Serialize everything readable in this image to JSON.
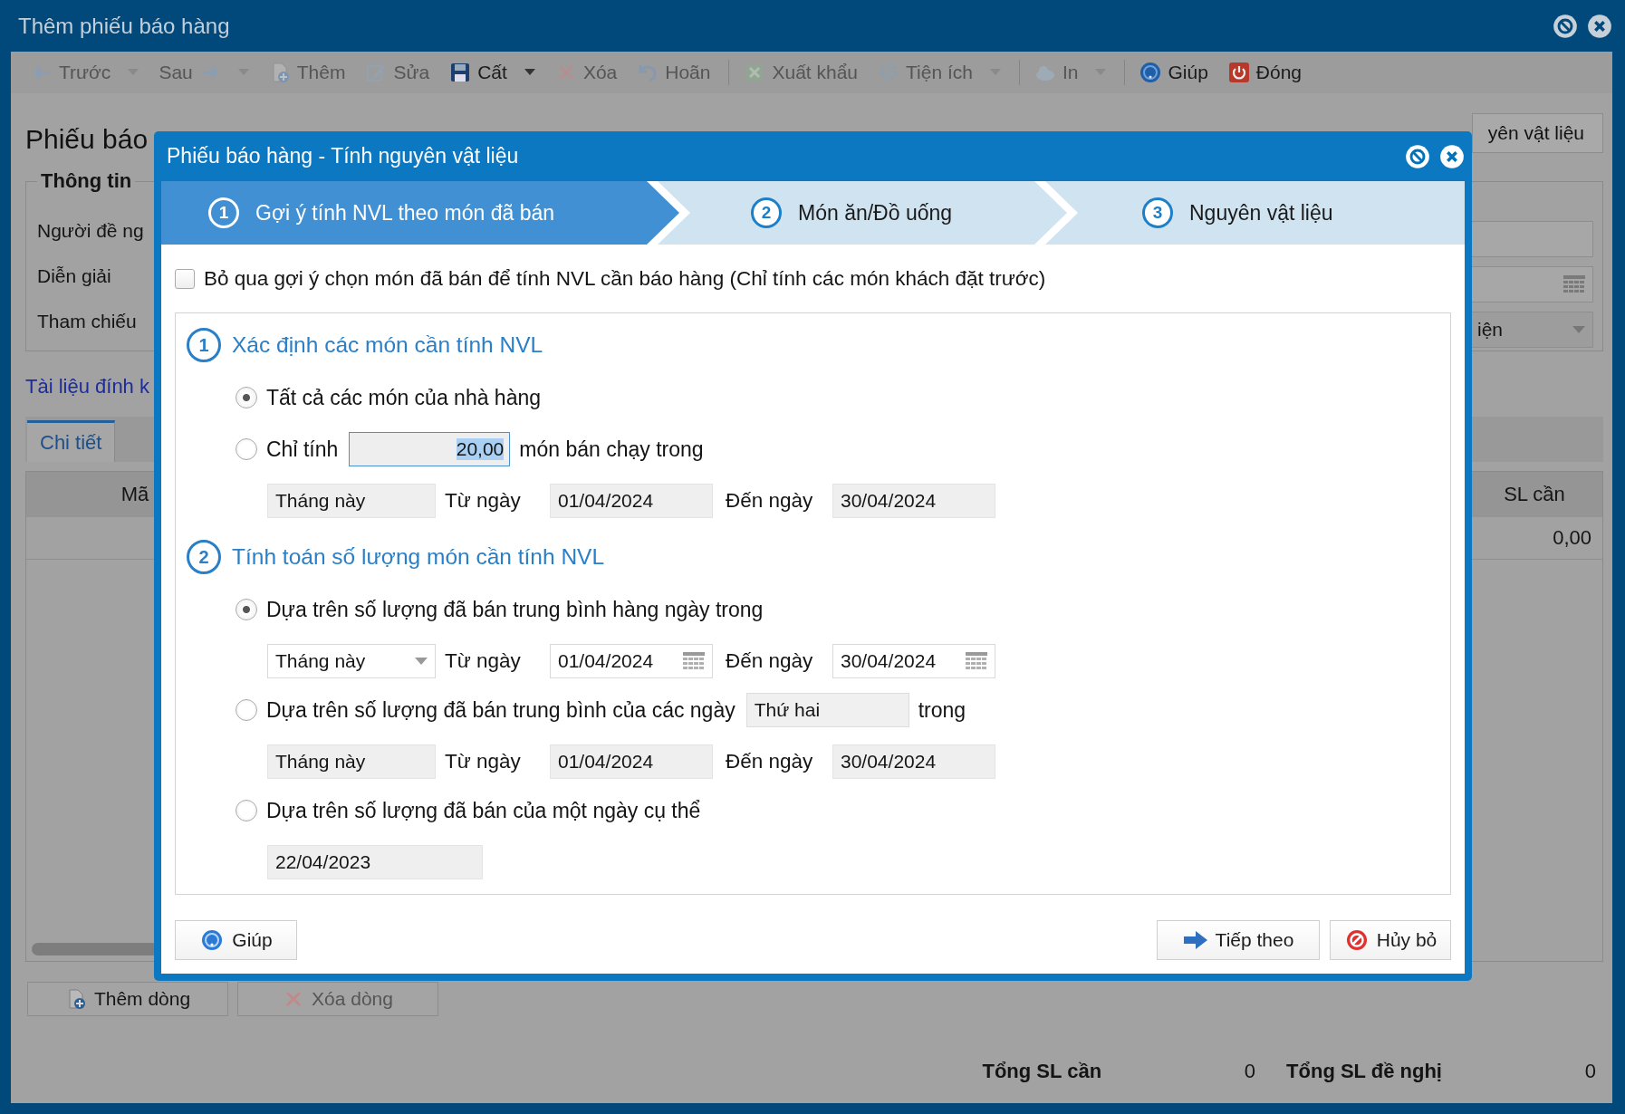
{
  "window": {
    "title": "Thêm phiếu báo hàng"
  },
  "toolbar": [
    {
      "label": "Trước",
      "kind": "back",
      "disabled": true,
      "dropdown": true,
      "group_start": false
    },
    {
      "label": "Sau",
      "kind": "forward",
      "disabled": true,
      "dropdown": true,
      "group_start": false
    },
    {
      "label": "Thêm",
      "kind": "add",
      "disabled": true,
      "dropdown": false,
      "group_start": false
    },
    {
      "label": "Sửa",
      "kind": "edit",
      "disabled": true,
      "dropdown": false,
      "group_start": false
    },
    {
      "label": "Cất",
      "kind": "save",
      "disabled": false,
      "dropdown": true,
      "group_start": false
    },
    {
      "label": "Xóa",
      "kind": "delete",
      "disabled": true,
      "dropdown": false,
      "group_start": false
    },
    {
      "label": "Hoãn",
      "kind": "undo",
      "disabled": true,
      "dropdown": false,
      "group_start": false
    },
    {
      "label": "Xuất khẩu",
      "kind": "export",
      "disabled": true,
      "dropdown": false,
      "group_start": true
    },
    {
      "label": "Tiện ích",
      "kind": "tools",
      "disabled": true,
      "dropdown": true,
      "group_start": false
    },
    {
      "label": "In",
      "kind": "print",
      "disabled": true,
      "dropdown": true,
      "group_start": true
    },
    {
      "label": "Giúp",
      "kind": "help",
      "disabled": false,
      "dropdown": false,
      "group_start": true
    },
    {
      "label": "Đóng",
      "kind": "close",
      "disabled": false,
      "dropdown": false,
      "group_start": false
    }
  ],
  "form": {
    "heading": "Phiếu báo",
    "side_button": "yên vật liệu",
    "group_title": "Thông tin",
    "field_labels": [
      "Người đề ng",
      "Diễn giải",
      "Tham chiếu"
    ],
    "dropdown_value": "iện",
    "attachment_link": "Tài liệu đính k",
    "tabs": [
      {
        "label": "Chi tiết",
        "selected": true
      }
    ],
    "grid": {
      "columns": [
        "Mã",
        "SL cần"
      ],
      "rows": [
        [
          "0,00"
        ]
      ]
    },
    "buttons": [
      {
        "label": "Thêm dòng",
        "kind": "add",
        "disabled": false
      },
      {
        "label": "Xóa dòng",
        "kind": "delete",
        "disabled": true
      }
    ],
    "totals": [
      {
        "label": "Tổng SL cần",
        "value": "0"
      },
      {
        "label": "Tổng SL đề nghị",
        "value": "0"
      }
    ]
  },
  "dialog": {
    "title": "Phiếu báo hàng - Tính nguyên vật liệu",
    "steps": [
      {
        "number": "1",
        "label": "Gợi ý tính NVL theo món đã bán",
        "selected": true
      },
      {
        "number": "2",
        "label": "Món ăn/Đồ uống",
        "selected": false
      },
      {
        "number": "3",
        "label": "Nguyên vật liệu",
        "selected": false
      }
    ],
    "skip_checkbox": {
      "label": "Bỏ qua gợi ý chọn món đã bán để tính NVL cần báo hàng (Chỉ tính các món khách đặt trước)",
      "checked": false
    },
    "sections": [
      {
        "number": "1",
        "title": "Xác định các món cần tính NVL",
        "options": [
          {
            "label": "Tất cả các món của nhà hàng",
            "selected": true
          },
          {
            "label": "Chỉ tính",
            "field": {
              "value": "20,00",
              "text_selected": true
            },
            "after": "món bán chạy trong",
            "selected": false,
            "period": {
              "value": "Tháng này",
              "from_label": "Từ ngày",
              "from": "01/04/2024",
              "to_label": "Đến ngày",
              "to": "30/04/2024"
            }
          }
        ]
      },
      {
        "number": "2",
        "title": "Tính toán số lượng món cần tính NVL",
        "options": [
          {
            "label": "Dựa trên số lượng đã bán trung bình hàng ngày trong",
            "selected": true,
            "period": {
              "value": "Tháng này",
              "from_label": "Từ ngày",
              "from": "01/04/2024",
              "to_label": "Đến ngày",
              "to": "30/04/2024"
            }
          },
          {
            "label": "Dựa trên số lượng đã bán trung bình của các ngày",
            "field": {
              "value": "Thứ hai",
              "text_selected": false
            },
            "after": "trong",
            "selected": false,
            "period": {
              "value": "Tháng này",
              "from_label": "Từ ngày",
              "from": "01/04/2024",
              "to_label": "Đến ngày",
              "to": "30/04/2024"
            }
          },
          {
            "label": "Dựa trên số lượng đã bán của một ngày cụ thể",
            "selected": false,
            "date": "22/04/2023"
          }
        ]
      }
    ],
    "buttons": [
      {
        "label": "Giúp",
        "kind": "help"
      },
      {
        "label": "Tiếp theo",
        "kind": "next"
      },
      {
        "label": "Hủy bỏ",
        "kind": "cancel"
      }
    ]
  }
}
